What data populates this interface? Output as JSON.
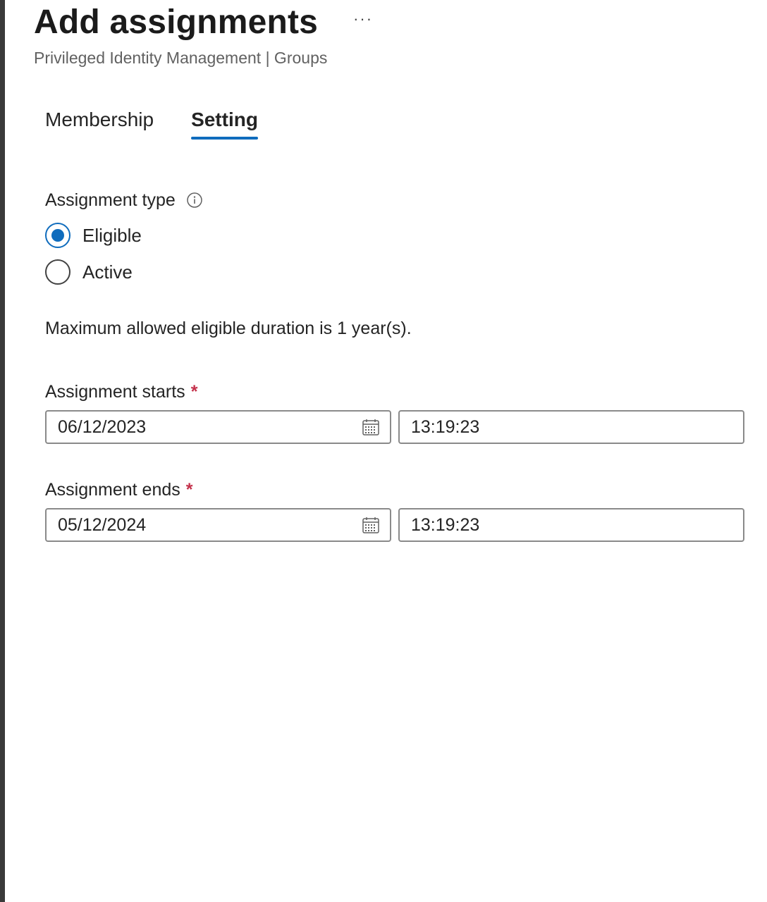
{
  "header": {
    "title": "Add assignments",
    "more_label": "···",
    "subtitle": "Privileged Identity Management | Groups"
  },
  "tabs": [
    {
      "label": "Membership",
      "active": false
    },
    {
      "label": "Setting",
      "active": true
    }
  ],
  "assignment_type": {
    "label": "Assignment type",
    "info_icon": "info-icon",
    "options": [
      {
        "label": "Eligible",
        "checked": true
      },
      {
        "label": "Active",
        "checked": false
      }
    ]
  },
  "duration_note": "Maximum allowed eligible duration is 1 year(s).",
  "assignment_starts": {
    "label": "Assignment starts",
    "required_mark": "*",
    "date": "06/12/2023",
    "time": "13:19:23"
  },
  "assignment_ends": {
    "label": "Assignment ends",
    "required_mark": "*",
    "date": "05/12/2024",
    "time": "13:19:23"
  },
  "colors": {
    "accent": "#0f6cbd",
    "required": "#c4314b",
    "border": "#8a8a8a"
  }
}
